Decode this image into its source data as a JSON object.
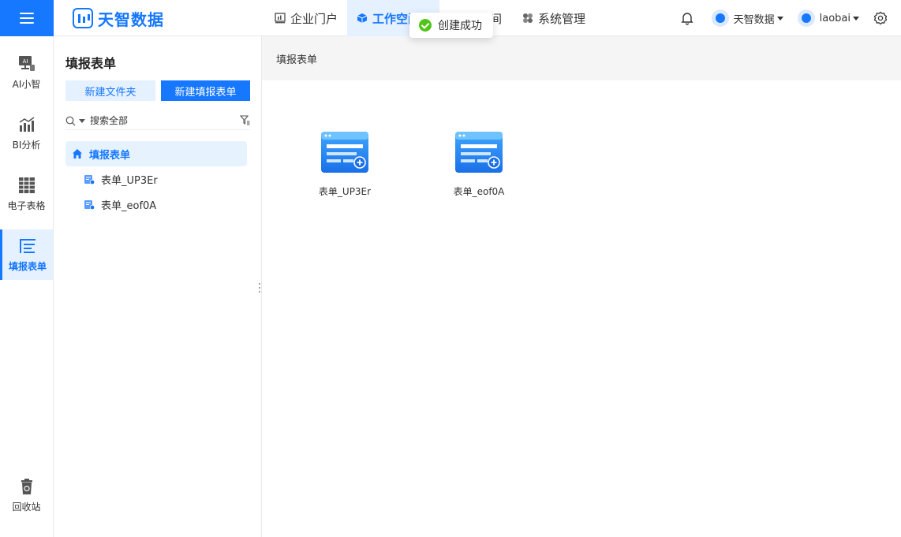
{
  "header": {
    "logo_text": "天智数据",
    "nav": [
      {
        "label": "企业门户",
        "icon": "chart-icon"
      },
      {
        "label": "工作空间",
        "icon": "cube-icon",
        "active": true
      },
      {
        "label": "间",
        "icon": ""
      },
      {
        "label": "系统管理",
        "icon": "windmill-icon"
      }
    ],
    "org_label": "天智数据",
    "user_label": "laobai"
  },
  "toast": {
    "message": "创建成功",
    "type": "success"
  },
  "rail": {
    "items": [
      {
        "label": "AI小智",
        "icon": "ai-monitor-icon"
      },
      {
        "label": "BI分析",
        "icon": "bar-chart-icon"
      },
      {
        "label": "电子表格",
        "icon": "grid-table-icon"
      },
      {
        "label": "填报表单",
        "icon": "form-list-icon",
        "active": true
      }
    ],
    "trash_label": "回收站"
  },
  "tree": {
    "title": "填报表单",
    "new_folder_label": "新建文件夹",
    "new_form_label": "新建填报表单",
    "search_placeholder": "搜索全部",
    "root_label": "填报表单",
    "leaves": [
      {
        "label": "表单_UP3Er"
      },
      {
        "label": "表单_eof0A"
      }
    ]
  },
  "main": {
    "breadcrumb": "填报表单",
    "cards": [
      {
        "label": "表单_UP3Er"
      },
      {
        "label": "表单_eof0A"
      }
    ]
  },
  "colors": {
    "primary": "#1677ff",
    "primary_light": "#e6f1ff",
    "success": "#52c41a"
  }
}
